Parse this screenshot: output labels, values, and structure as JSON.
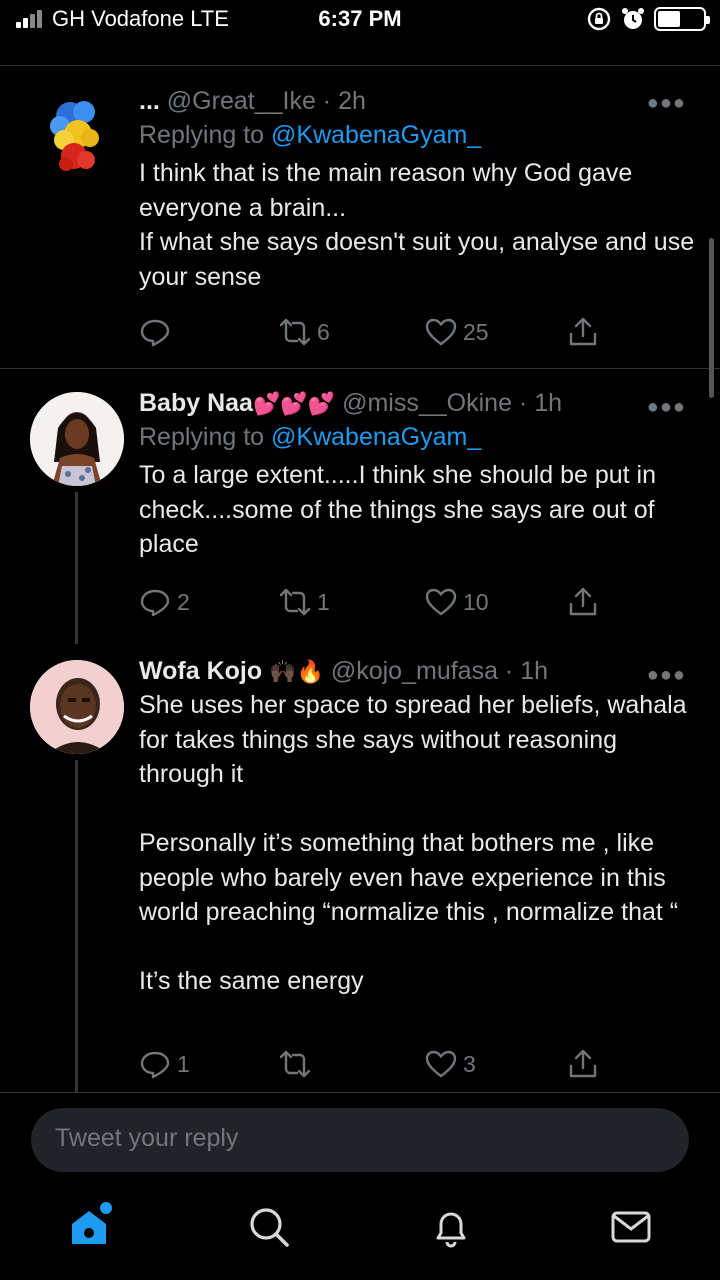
{
  "status_bar": {
    "carrier": "GH Vodafone  LTE",
    "time": "6:37 PM"
  },
  "tweets": [
    {
      "prefix": "...",
      "display_name": "",
      "handle": "@Great__Ike",
      "time": "2h",
      "replying_label": "Replying to",
      "replying_to": "@KwabenaGyam_",
      "text": "I think that is the main reason why God gave everyone a brain...\nIf what she says doesn't suit you, analyse and use your sense",
      "replies": "",
      "retweets": "6",
      "likes": "25"
    },
    {
      "display_name": "Baby Naa",
      "emoji": "💕💕💕",
      "handle": "@miss__Okine",
      "time": "1h",
      "replying_label": "Replying to",
      "replying_to": "@KwabenaGyam_",
      "text": "To a large extent.....I think she should be put in check....some of the things she says are out of place",
      "replies": "2",
      "retweets": "1",
      "likes": "10"
    },
    {
      "display_name": "Wofa Kojo",
      "emoji": "🙌🏿🔥",
      "handle": "@kojo_mufasa",
      "time": "1h",
      "text": "She uses her space to spread her beliefs, wahala for takes things she says without reasoning through it\n\nPersonally it’s something that bothers me , like people who barely even have experience in this world preaching “normalize this , normalize that “\n\nIt’s the same energy",
      "replies": "1",
      "retweets": "",
      "likes": "3"
    }
  ],
  "composer": {
    "placeholder": "Tweet your reply"
  },
  "tabs": [
    "home-icon",
    "search-icon",
    "notifications-icon",
    "messages-icon"
  ],
  "colors": {
    "accent": "#1d9bf0",
    "muted": "#71767b",
    "background": "#000000"
  }
}
